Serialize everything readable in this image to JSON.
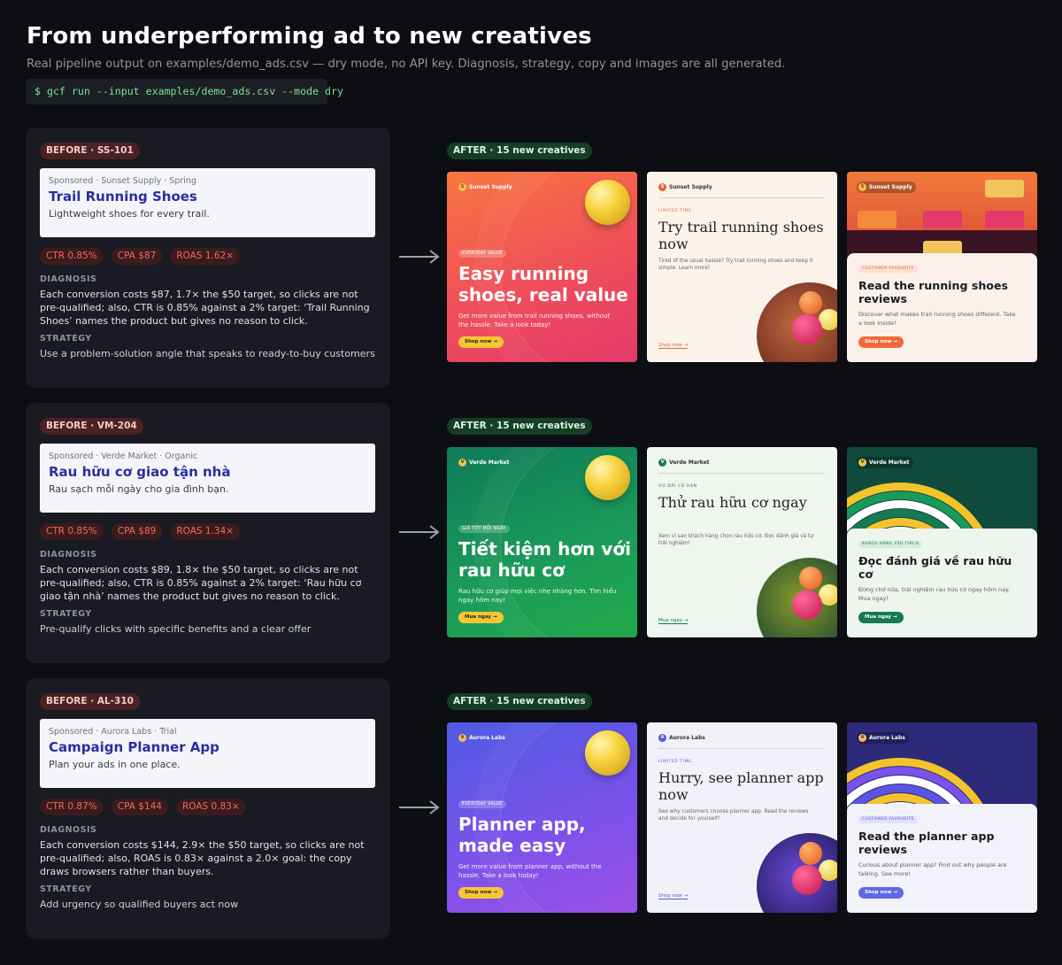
{
  "header": {
    "title": "From underperforming ad to new creatives",
    "subtitle": "Real pipeline output on examples/demo_ads.csv — dry mode, no API key. Diagnosis, strategy, copy and images are all generated.",
    "command": "$ gcf run --input examples/demo_ads.csv --mode dry"
  },
  "labels": {
    "diagnosis": "DIAGNOSIS",
    "strategy": "STRATEGY"
  },
  "colors": {
    "background": "#0d0e13",
    "panel": "#191a22",
    "before_badge": "#4a2223",
    "after_badge": "#163d26",
    "metric_text": "#f1685e",
    "ad_title": "#2b2ea0",
    "command_text": "#79e38f"
  },
  "rows": [
    {
      "before_badge": "BEFORE · SS-101",
      "ad": {
        "meta": "Sponsored · Sunset Supply · Spring",
        "title": "Trail Running Shoes",
        "description": "Lightweight shoes for every trail."
      },
      "metrics": [
        "CTR 0.85%",
        "CPA $87",
        "ROAS 1.62×"
      ],
      "diagnosis": "Each conversion costs $87, 1.7× the $50 target, so clicks are not pre-qualified; also, CTR is 0.85% against a 2% target: ‘Trail Running Shoes’ names the product but gives no reason to click.",
      "strategy": "Use a problem-solution angle that speaks to ready-to-buy customers",
      "after_badge": "AFTER · 15 new creatives",
      "creatives": [
        {
          "brand": "Sunset Supply",
          "eyebrow": "EVERYDAY VALUE",
          "title": "Easy running shoes, real value",
          "body": "Get more value from trail running shoes, without the hassle. Take a look today!",
          "cta": "Shop now →"
        },
        {
          "brand": "Sunset Supply",
          "eyebrow": "LIMITED TIME",
          "title": "Try trail running shoes now",
          "body": "Tired of the usual hassle? Try trail running shoes and keep it simple. Learn more!",
          "cta": "Shop now →"
        },
        {
          "brand": "Sunset Supply",
          "eyebrow": "CUSTOMER FAVOURITE",
          "title": "Read the running shoes reviews",
          "body": "Discover what makes trail running shoes different. Take a look inside!",
          "cta": "Shop now →"
        }
      ]
    },
    {
      "before_badge": "BEFORE · VM-204",
      "ad": {
        "meta": "Sponsored · Verde Market · Organic",
        "title": "Rau hữu cơ giao tận nhà",
        "description": "Rau sạch mỗi ngày cho gia đình bạn."
      },
      "metrics": [
        "CTR 0.85%",
        "CPA $89",
        "ROAS 1.34×"
      ],
      "diagnosis": "Each conversion costs $89, 1.8× the $50 target, so clicks are not pre-qualified; also, CTR is 0.85% against a 2% target: ‘Rau hữu cơ giao tận nhà’ names the product but gives no reason to click.",
      "strategy": "Pre-qualify clicks with specific benefits and a clear offer",
      "after_badge": "AFTER · 15 new creatives",
      "creatives": [
        {
          "brand": "Verde Market",
          "eyebrow": "GIÁ TỐT MỖI NGÀY",
          "title": "Tiết kiệm hơn với rau hữu cơ",
          "body": "Rau hữu cơ giúp mọi việc nhẹ nhàng hơn. Tìm hiểu ngay hôm nay!",
          "cta": "Mua ngay →"
        },
        {
          "brand": "Verde Market",
          "eyebrow": "ƯU ĐÃI CÓ HẠN",
          "title": "Thử rau hữu cơ ngay",
          "body": "Xem vì sao khách hàng chọn rau hữu cơ. Đọc đánh giá và tự trải nghiệm!",
          "cta": "Mua ngay →"
        },
        {
          "brand": "Verde Market",
          "eyebrow": "KHÁCH HÀNG YÊU THÍCH",
          "title": "Đọc đánh giá về rau hữu cơ",
          "body": "Đừng chờ nữa, trải nghiệm rau hữu cơ ngay hôm nay. Mua ngay!",
          "cta": "Mua ngay →"
        }
      ]
    },
    {
      "before_badge": "BEFORE · AL-310",
      "ad": {
        "meta": "Sponsored · Aurora Labs · Trial",
        "title": "Campaign Planner App",
        "description": "Plan your ads in one place."
      },
      "metrics": [
        "CTR 0.87%",
        "CPA $144",
        "ROAS 0.83×"
      ],
      "diagnosis": "Each conversion costs $144, 2.9× the $50 target, so clicks are not pre-qualified; also, ROAS is 0.83× against a 2.0× goal: the copy draws browsers rather than buyers.",
      "strategy": "Add urgency so qualified buyers act now",
      "after_badge": "AFTER · 15 new creatives",
      "creatives": [
        {
          "brand": "Aurora Labs",
          "eyebrow": "EVERYDAY VALUE",
          "title": "Planner app, made easy",
          "body": "Get more value from planner app, without the hassle. Take a look today!",
          "cta": "Shop now →"
        },
        {
          "brand": "Aurora Labs",
          "eyebrow": "LIMITED TIME",
          "title": "Hurry, see planner app now",
          "body": "See why customers choose planner app. Read the reviews and decide for yourself!",
          "cta": "Shop now →"
        },
        {
          "brand": "Aurora Labs",
          "eyebrow": "CUSTOMER FAVOURITE",
          "title": "Read the planner app reviews",
          "body": "Curious about planner app? Find out why people are talking. See more!",
          "cta": "Shop now →"
        }
      ]
    }
  ]
}
